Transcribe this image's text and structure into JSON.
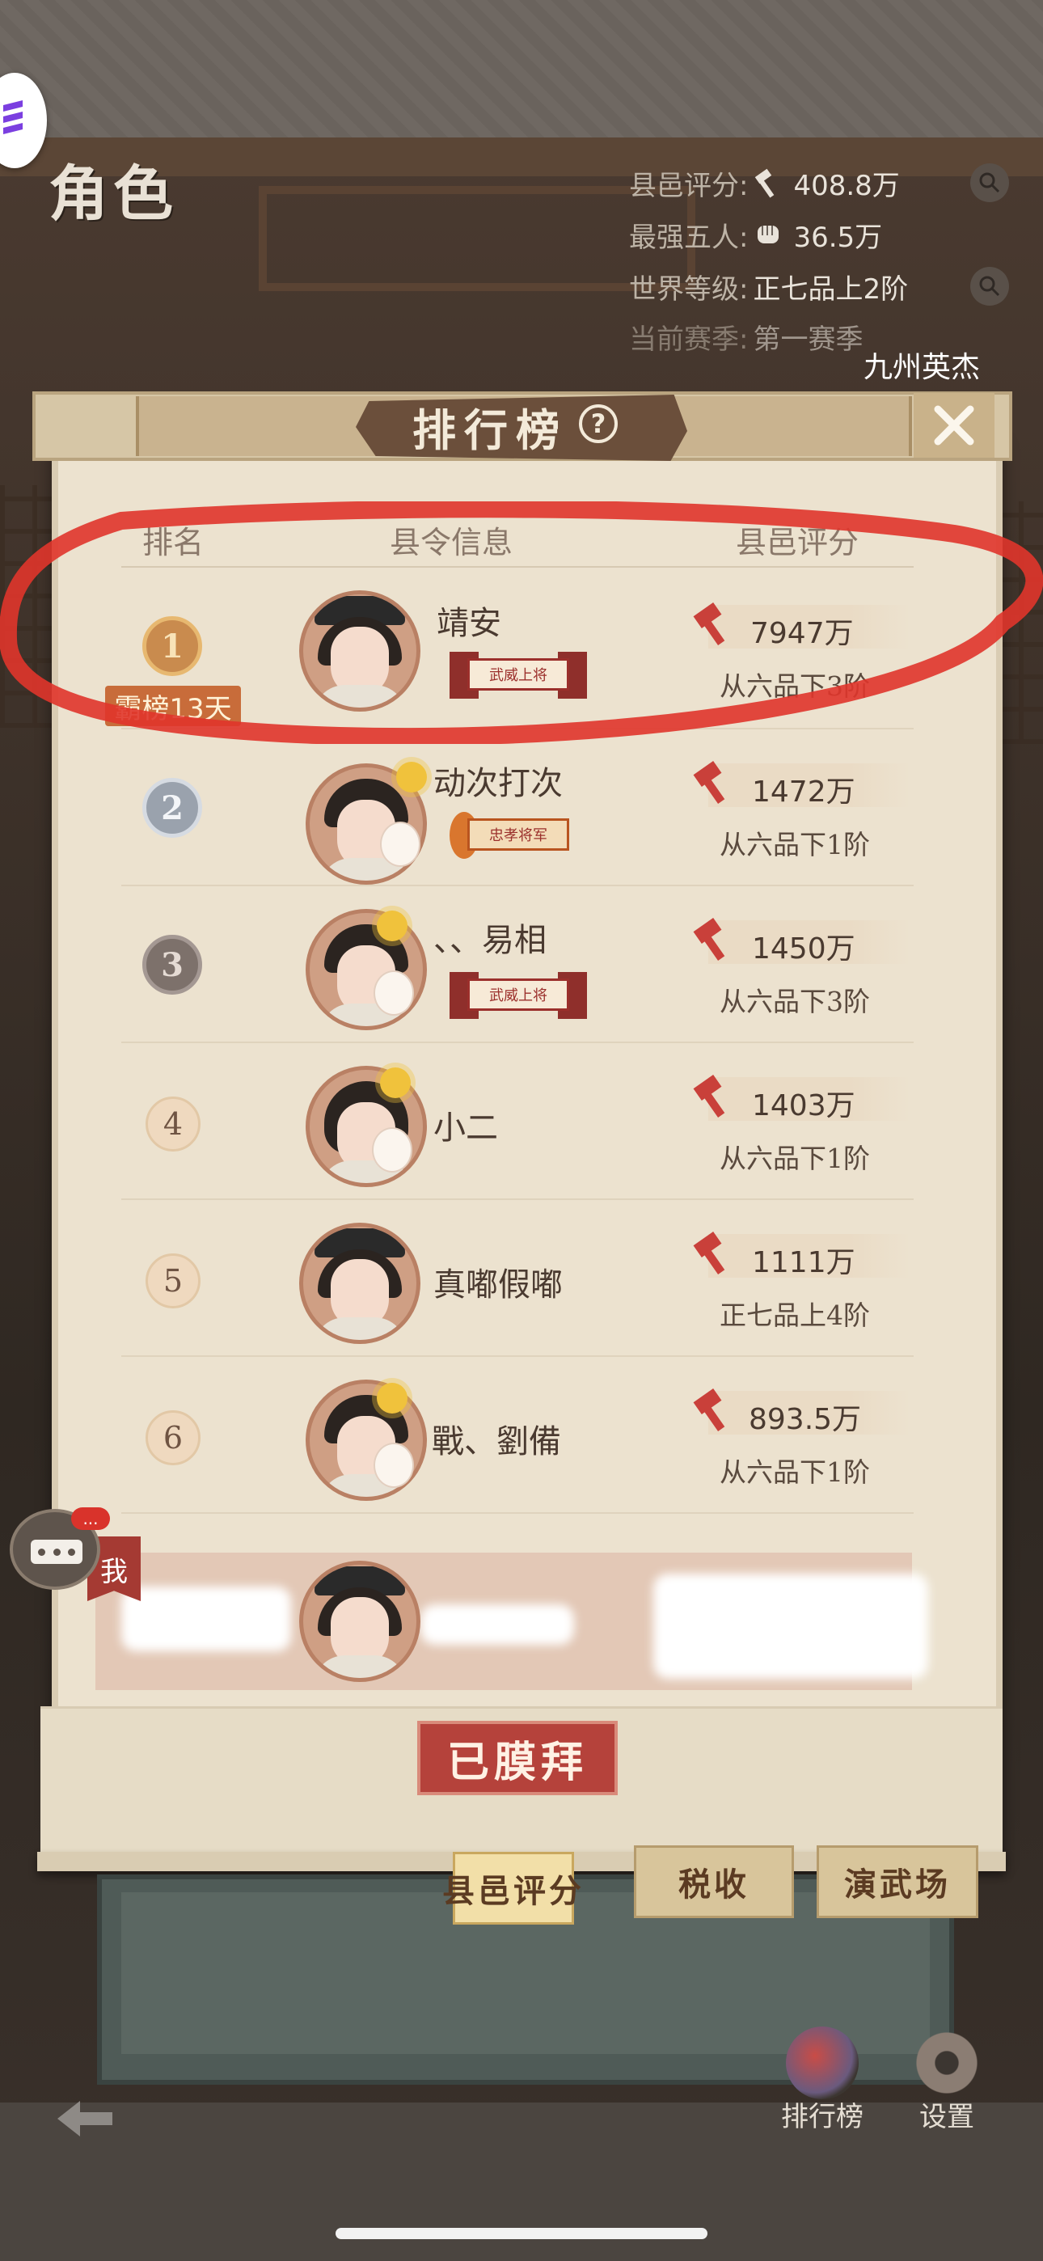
{
  "page": {
    "title": "角色",
    "header_subtitle": "九州英杰"
  },
  "stats": [
    {
      "label": "县邑评分:",
      "value": "408.8万",
      "icon": "hammer-icon"
    },
    {
      "label": "最强五人:",
      "value": "36.5万",
      "icon": "fist-icon"
    },
    {
      "label": "世界等级:",
      "value": "正七品上2阶",
      "icon": ""
    },
    {
      "label": "当前赛季:",
      "value": "第一赛季",
      "icon": ""
    }
  ],
  "popup": {
    "title": "排行榜"
  },
  "table": {
    "headers": [
      "排名",
      "县令信息",
      "县邑评分"
    ]
  },
  "rank1_badge": "霸榜13天",
  "rows": [
    {
      "rank": "1",
      "name": "靖安",
      "score": "7947万",
      "grade": "从六品下3阶",
      "title": "武威上将"
    },
    {
      "rank": "2",
      "name": "动次打次",
      "score": "1472万",
      "grade": "从六品下1阶",
      "title": "忠孝将军"
    },
    {
      "rank": "3",
      "name": "、、易相",
      "score": "1450万",
      "grade": "从六品下3阶",
      "title": "武威上将"
    },
    {
      "rank": "4",
      "name": "小二",
      "score": "1403万",
      "grade": "从六品下1阶",
      "title": ""
    },
    {
      "rank": "5",
      "name": "真嘟假嘟",
      "score": "1111万",
      "grade": "正七品上4阶",
      "title": ""
    },
    {
      "rank": "6",
      "name": "戰、劉備",
      "score": "893.5万",
      "grade": "从六品下1阶",
      "title": ""
    }
  ],
  "my_row": {
    "badge": "我"
  },
  "chat": {
    "notification": "..."
  },
  "worship_button": "已膜拜",
  "tabs": [
    "县邑评分",
    "税收",
    "演武场"
  ],
  "bottom_nav": [
    {
      "label": "排行榜"
    },
    {
      "label": "设置"
    }
  ],
  "colors": {
    "annotation": "#e0352b",
    "accent_red": "#b5423b",
    "paper": "#ece2cf"
  }
}
